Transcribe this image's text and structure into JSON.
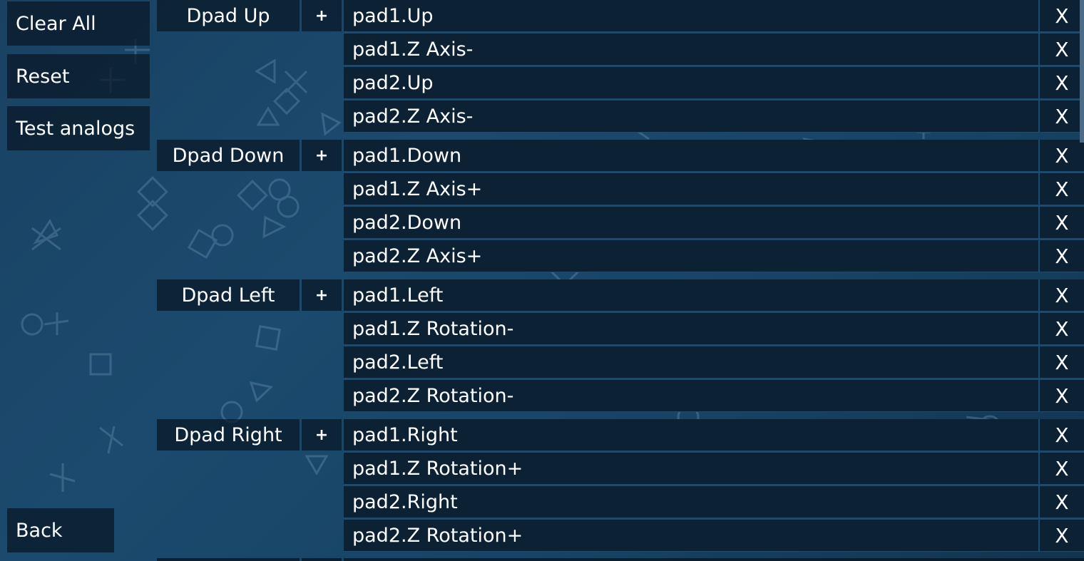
{
  "side_buttons": {
    "clear_all": "Clear All",
    "reset": "Reset",
    "test_analogs": "Test analogs",
    "back": "Back"
  },
  "add_label": "+",
  "remove_label": "X",
  "groups": [
    {
      "label": "Dpad Up",
      "bindings": [
        "pad1.Up",
        "pad1.Z Axis-",
        "pad2.Up",
        "pad2.Z Axis-"
      ]
    },
    {
      "label": "Dpad Down",
      "bindings": [
        "pad1.Down",
        "pad1.Z Axis+",
        "pad2.Down",
        "pad2.Z Axis+"
      ]
    },
    {
      "label": "Dpad Left",
      "bindings": [
        "pad1.Left",
        "pad1.Z Rotation-",
        "pad2.Left",
        "pad2.Z Rotation-"
      ]
    },
    {
      "label": "Dpad Right",
      "bindings": [
        "pad1.Right",
        "pad1.Z Rotation+",
        "pad2.Right",
        "pad2.Z Rotation+"
      ]
    }
  ],
  "colors": {
    "background": "#1b4a6e",
    "panel": "#081624",
    "text": "#ffffff",
    "background_symbols": "#5f86a8"
  }
}
